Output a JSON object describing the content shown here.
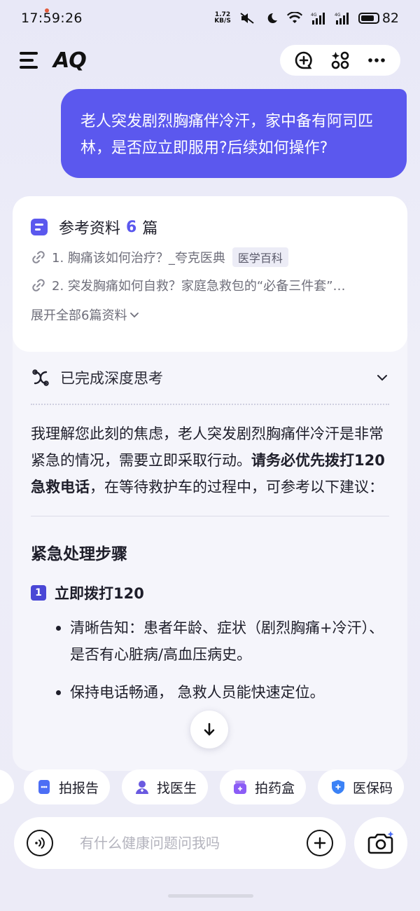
{
  "status_bar": {
    "time": "17:59:26",
    "net_speed_value": "1.72",
    "net_speed_unit": "KB/S",
    "battery": "82",
    "battery_level": 0.82
  },
  "top_bar": {
    "logo": "AQ",
    "icons": [
      "menu-icon",
      "new-chat-icon",
      "apps-icon",
      "more-icon"
    ]
  },
  "user_message": "老人突发剧烈胸痛伴冷汗，家中备有阿司匹林，是否应立即服用?后续如何操作?",
  "references": {
    "label_prefix": "参考资料",
    "count": "6",
    "label_suffix": "篇",
    "items": [
      {
        "text": "1. 胸痛该如何治疗？_夸克医典",
        "tag": "医学百科"
      },
      {
        "text": "2. 突发胸痛如何自救？家庭急救包的“必备三件套”…",
        "tag": ""
      }
    ],
    "expand_label": "展开全部6篇资料"
  },
  "thinking": {
    "label": "已完成深度思考"
  },
  "answer": {
    "intro_part1": "我理解您此刻的焦虑，老人突发剧烈胸痛伴冷汗是非常紧急的情况，需要立即采取行动。",
    "intro_bold": "请务必优先拨打120急救电话",
    "intro_part2": "，在等待救护车的过程中，可参考以下建议：",
    "section_title": "紧急处理步骤",
    "step_number": "1",
    "step_title": "立即拨打120",
    "bullets": [
      "清晰告知：患者年龄、症状（剧烈胸痛+冷汗）、是否有心脏病/高血压病史。",
      "保持电话畅通，     急救人员能快速定位。"
    ]
  },
  "chips": [
    {
      "label": "拍报告",
      "icon": "report-icon"
    },
    {
      "label": "找医生",
      "icon": "doctor-icon"
    },
    {
      "label": "拍药盒",
      "icon": "medicine-box-icon"
    },
    {
      "label": "医保码",
      "icon": "insurance-shield-icon"
    }
  ],
  "input": {
    "placeholder": "有什么健康问题问我吗"
  },
  "colors": {
    "accent": "#5b58ee",
    "background": "#ececf7",
    "card": "#ffffff"
  }
}
